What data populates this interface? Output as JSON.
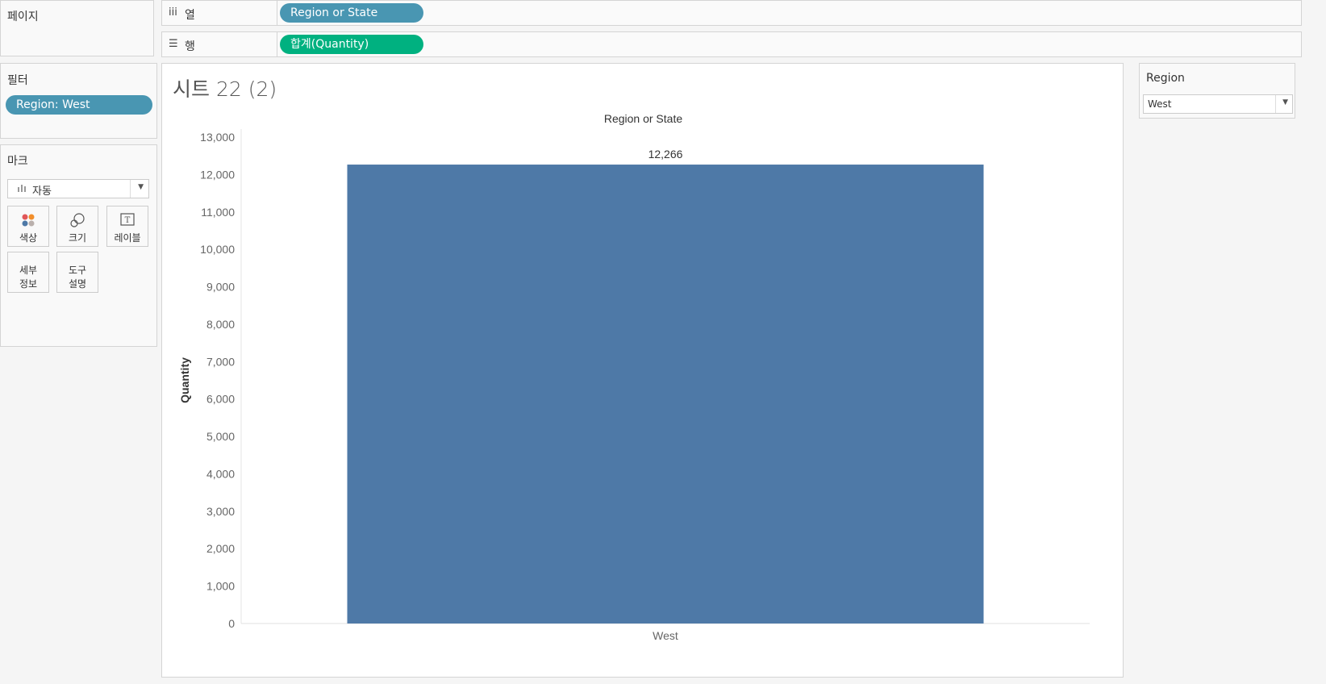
{
  "pages_panel": {
    "title": "페이지"
  },
  "columns_shelf": {
    "icon": "iii",
    "label": "열",
    "pill": "Region or State"
  },
  "rows_shelf": {
    "icon": "☰",
    "label": "행",
    "pill": "합계(Quantity)"
  },
  "filters_panel": {
    "title": "필터",
    "pill": "Region: West"
  },
  "marks_panel": {
    "title": "마크",
    "type_icon": "bar-chart-icon",
    "type_value": "자동",
    "cards": [
      {
        "name": "color",
        "label": "색상",
        "icon": "color-dots-icon"
      },
      {
        "name": "size",
        "label": "크기",
        "icon": "size-circles-icon"
      },
      {
        "name": "label",
        "label": "레이블",
        "icon": "text-label-icon"
      },
      {
        "name": "detail",
        "line1": "세부",
        "line2": "정보",
        "icon": ""
      },
      {
        "name": "tooltip",
        "line1": "도구",
        "line2": "설명",
        "icon": ""
      }
    ]
  },
  "sheet": {
    "title": "시트 22 (2)"
  },
  "region_filter": {
    "title": "Region",
    "value": "West"
  },
  "colors": {
    "bar": "#4e79a7",
    "pill_blue": "#4996b2",
    "pill_green": "#00b180"
  },
  "chart_data": {
    "type": "bar",
    "title": "",
    "column_header": "Region or State",
    "xlabel": "",
    "ylabel": "Quantity",
    "categories": [
      "West"
    ],
    "values": [
      12266
    ],
    "value_labels": [
      "12,266"
    ],
    "ylim": [
      0,
      13000
    ],
    "yticks": [
      0,
      1000,
      2000,
      3000,
      4000,
      5000,
      6000,
      7000,
      8000,
      9000,
      10000,
      11000,
      12000,
      13000
    ],
    "ytick_labels": [
      "0",
      "1,000",
      "2,000",
      "3,000",
      "4,000",
      "5,000",
      "6,000",
      "7,000",
      "8,000",
      "9,000",
      "10,000",
      "11,000",
      "12,000",
      "13,000"
    ],
    "grid": false,
    "legend": "none"
  }
}
